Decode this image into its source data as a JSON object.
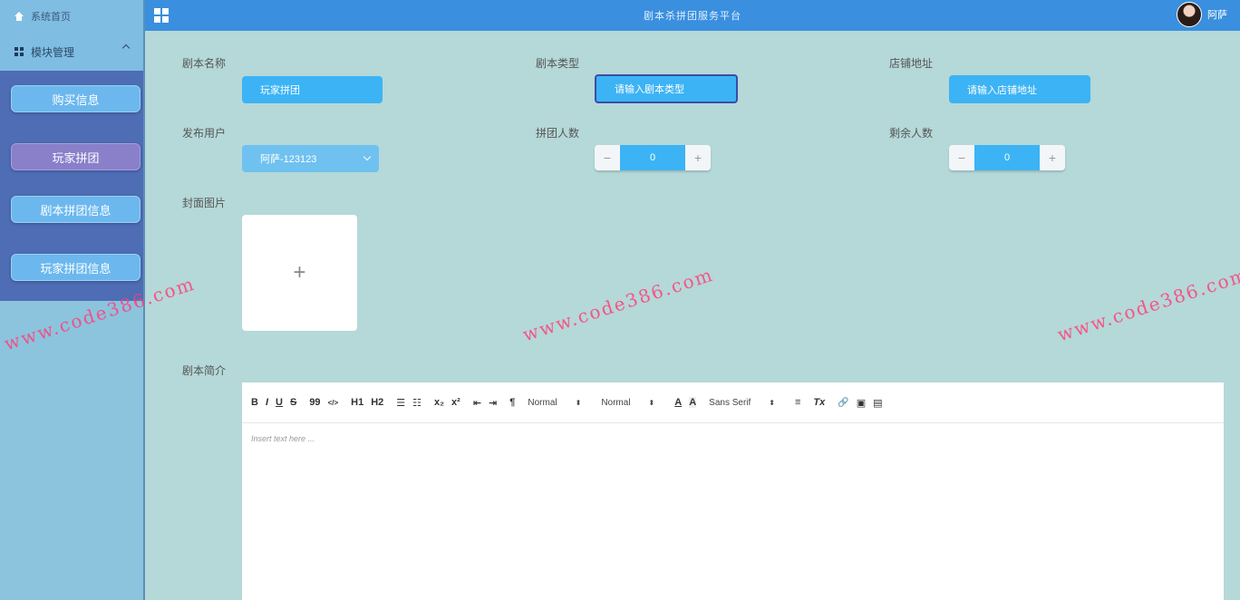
{
  "sidebar": {
    "home_label": "系统首页",
    "group_label": "模块管理",
    "items": [
      {
        "label": "购买信息"
      },
      {
        "label": "玩家拼团"
      },
      {
        "label": "剧本拼团信息"
      },
      {
        "label": "玩家拼团信息"
      }
    ]
  },
  "header": {
    "title": "剧本杀拼团服务平台",
    "username": "阿萨"
  },
  "form": {
    "script_name": {
      "label": "剧本名称",
      "value": "玩家拼团"
    },
    "script_type": {
      "label": "剧本类型",
      "placeholder": "请输入剧本类型"
    },
    "store_address": {
      "label": "店铺地址",
      "placeholder": "请输入店铺地址"
    },
    "publisher": {
      "label": "发布用户",
      "value": "阿萨-123123"
    },
    "group_count": {
      "label": "拼团人数",
      "value": "0"
    },
    "remaining": {
      "label": "剩余人数",
      "value": "0"
    },
    "cover": {
      "label": "封面图片",
      "plus": "+"
    },
    "intro": {
      "label": "剧本简介"
    }
  },
  "editor": {
    "toolbar": {
      "bold": "B",
      "italic": "I",
      "underline": "U",
      "strike": "S",
      "quote": "99",
      "code": "</>",
      "h1": "H1",
      "h2": "H2",
      "ol": "☰",
      "ul": "☷",
      "sub": "x₂",
      "sup": "x²",
      "outdent": "⇤",
      "indent": "⇥",
      "direction": "¶",
      "size": "Normal",
      "header": "Normal",
      "color": "A",
      "background": "A",
      "font": "Sans Serif",
      "align": "≡",
      "clean": "Tx",
      "link": "🔗",
      "image": "▣",
      "video": "▤"
    },
    "placeholder": "Insert text here ..."
  },
  "watermark": "www.code386.com"
}
